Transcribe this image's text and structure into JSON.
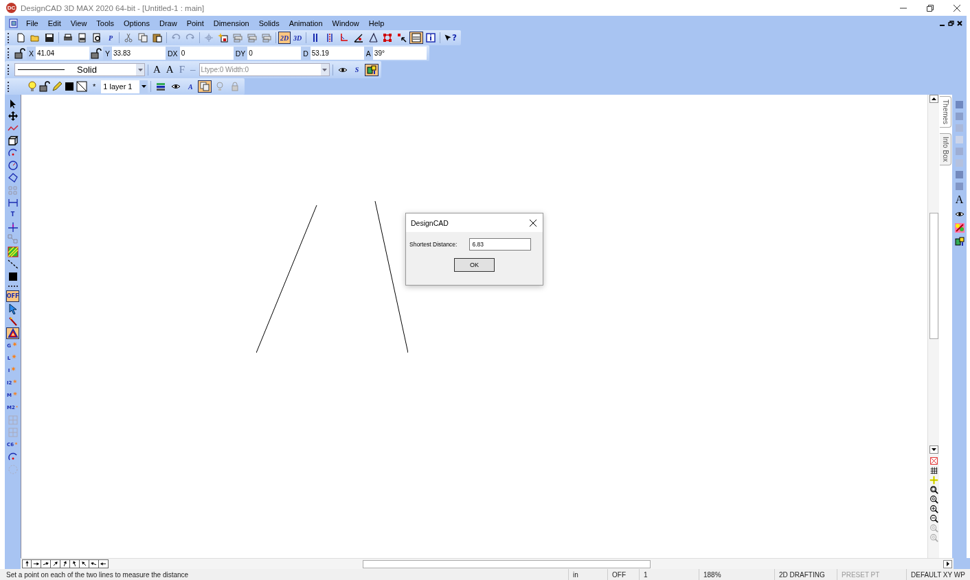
{
  "window": {
    "title": "DesignCAD 3D MAX 2020 64-bit - [Untitled-1 : main]",
    "app_badge": "DC"
  },
  "menu": [
    "File",
    "Edit",
    "View",
    "Tools",
    "Options",
    "Draw",
    "Point",
    "Dimension",
    "Solids",
    "Animation",
    "Window",
    "Help"
  ],
  "toolbar": [
    {
      "kind": "new-document",
      "selected": false
    },
    {
      "kind": "folder",
      "selected": false
    },
    {
      "kind": "floppy-disk",
      "selected": false
    },
    {
      "kind": "sep"
    },
    {
      "kind": "printer",
      "selected": false
    },
    {
      "kind": "printer-page",
      "selected": false
    },
    {
      "kind": "magnifier-page",
      "selected": false
    },
    {
      "kind": "letter",
      "label": "P",
      "selected": false
    },
    {
      "kind": "sep"
    },
    {
      "kind": "scissors",
      "selected": false
    },
    {
      "kind": "copy-pages",
      "selected": false
    },
    {
      "kind": "clipboard",
      "selected": false
    },
    {
      "kind": "sep"
    },
    {
      "kind": "undo-arrow",
      "selected": false
    },
    {
      "kind": "redo-arrow",
      "selected": false
    },
    {
      "kind": "sep"
    },
    {
      "kind": "crosshair",
      "selected": false
    },
    {
      "kind": "sparkle-page",
      "selected": false
    },
    {
      "kind": "stacked-frames",
      "selected": false
    },
    {
      "kind": "stacked-frames",
      "selected": false
    },
    {
      "kind": "stacked-frames",
      "selected": false
    },
    {
      "kind": "sep"
    },
    {
      "kind": "letter",
      "label": "2D",
      "selected": true
    },
    {
      "kind": "letter",
      "label": "3D",
      "selected": false
    },
    {
      "kind": "sep"
    },
    {
      "kind": "double-bar",
      "selected": false
    },
    {
      "kind": "dotted-bars",
      "selected": false
    },
    {
      "kind": "axes-arrow",
      "selected": false
    },
    {
      "kind": "angle-mark",
      "selected": false
    },
    {
      "kind": "angle-lines",
      "selected": false
    },
    {
      "kind": "square-handles",
      "selected": false
    },
    {
      "kind": "pointer-dot",
      "selected": false
    },
    {
      "kind": "panel",
      "selected": true
    },
    {
      "kind": "info",
      "selected": false
    },
    {
      "kind": "sep"
    },
    {
      "kind": "help-pointer",
      "label": "?",
      "selected": false
    }
  ],
  "coordinates": [
    {
      "kind": "locked",
      "label": "X",
      "value": "41.04"
    },
    {
      "kind": "locked",
      "label": "Y",
      "value": "33.83"
    },
    {
      "kind": "plain",
      "label": "DX",
      "value": "0"
    },
    {
      "kind": "plain",
      "label": "DY",
      "value": "0"
    },
    {
      "kind": "plain",
      "label": "D",
      "value": "53.19"
    },
    {
      "kind": "plain",
      "label": "A",
      "value": "39°"
    }
  ],
  "line_bar": {
    "line_style": "Solid",
    "font_buttons": [
      "A",
      "A",
      "F",
      "–"
    ],
    "line_type": {
      "value": "Ltype:0  Width:0",
      "disabled": true
    },
    "extra_buttons": [
      {
        "kind": "eye-pointer",
        "selected": false
      },
      {
        "kind": "letter",
        "label": "S",
        "selected": false
      },
      {
        "kind": "layers-arrow",
        "selected": true
      }
    ]
  },
  "layer_bar": {
    "marker": "*",
    "layer": "1  layer 1",
    "buttons": [
      {
        "kind": "layers-stack",
        "selected": false
      },
      {
        "kind": "eye-pointer",
        "selected": false
      },
      {
        "kind": "letter",
        "label": "A",
        "selected": false
      },
      {
        "kind": "copy-pages",
        "selected": true
      },
      {
        "kind": "bulb-grey",
        "selected": false
      },
      {
        "kind": "lock-grey",
        "selected": false
      }
    ]
  },
  "left_tools": [
    {
      "kind": "arrow-pointer",
      "selected": false
    },
    {
      "kind": "move-cross",
      "selected": false
    },
    {
      "kind": "polyline",
      "selected": false
    },
    {
      "kind": "cube",
      "selected": false
    },
    {
      "kind": "arc",
      "selected": false
    },
    {
      "kind": "circle",
      "selected": false
    },
    {
      "kind": "polygon",
      "selected": false
    },
    {
      "kind": "grid-dots",
      "selected": false
    },
    {
      "kind": "dimension",
      "selected": false
    },
    {
      "kind": "letter",
      "label": "T",
      "selected": false
    },
    {
      "kind": "cross-line",
      "selected": false
    },
    {
      "kind": "snap-boxes",
      "selected": false
    },
    {
      "kind": "hatch",
      "selected": false
    },
    {
      "kind": "dashed-line",
      "selected": false
    },
    {
      "kind": "black-square",
      "selected": false
    },
    {
      "kind": "grip"
    },
    {
      "kind": "letter",
      "label": "OFF",
      "selected": true
    },
    {
      "kind": "blue-pointer",
      "selected": false
    },
    {
      "kind": "wand",
      "selected": false
    },
    {
      "kind": "triangle",
      "selected": true
    },
    {
      "kind": "snap-letter",
      "label": "G",
      "selected": false
    },
    {
      "kind": "snap-letter",
      "label": "L",
      "selected": false
    },
    {
      "kind": "snap-letter",
      "label": "I",
      "selected": false
    },
    {
      "kind": "snap-letter",
      "label": "I2",
      "selected": false
    },
    {
      "kind": "snap-letter",
      "label": "M",
      "selected": false
    },
    {
      "kind": "snap-letter",
      "label": "M2",
      "selected": false
    },
    {
      "kind": "grid-box",
      "selected": false
    },
    {
      "kind": "grid-box",
      "selected": false
    },
    {
      "kind": "snap-letter",
      "label": "C6",
      "selected": false
    },
    {
      "kind": "arc",
      "selected": false
    },
    {
      "kind": "dotted-circle",
      "selected": false
    }
  ],
  "side_tabs": [
    {
      "label": "Themes",
      "selected": true
    },
    {
      "label": "Info Box",
      "selected": false
    }
  ],
  "right_tools": [
    {
      "kind": "swatch",
      "color": "#6f88c0"
    },
    {
      "kind": "swatch",
      "color": "#8a9fcc"
    },
    {
      "kind": "swatch",
      "color": "#a9b8da"
    },
    {
      "kind": "swatch",
      "color": "#ccd5ea"
    },
    {
      "kind": "swatch",
      "color": "#9eaed4"
    },
    {
      "kind": "swatch",
      "color": "#b4c1df"
    },
    {
      "kind": "swatch",
      "color": "#7389bd"
    },
    {
      "kind": "swatch",
      "color": "#8196c6"
    },
    {
      "kind": "letter",
      "label": "A"
    },
    {
      "kind": "eye-pointer"
    },
    {
      "kind": "palette"
    },
    {
      "kind": "layers-arrow"
    }
  ],
  "zoom_tools": [
    {
      "kind": "red-x"
    },
    {
      "kind": "hash"
    },
    {
      "kind": "yellow-cross"
    },
    {
      "kind": "zoom-window"
    },
    {
      "kind": "zoom-extents"
    },
    {
      "kind": "zoom-in"
    },
    {
      "kind": "zoom-out"
    },
    {
      "kind": "zoom-grey"
    },
    {
      "kind": "zoom-grey"
    }
  ],
  "direction_buttons": [
    {
      "kind": "up"
    },
    {
      "kind": "right"
    },
    {
      "kind": "low-right"
    },
    {
      "kind": "up-right"
    },
    {
      "kind": "steep-right"
    },
    {
      "kind": "steep-left"
    },
    {
      "kind": "up-left"
    },
    {
      "kind": "low-left"
    },
    {
      "kind": "left"
    }
  ],
  "dialog": {
    "title": "DesignCAD",
    "label": "Shortest Distance:",
    "value": "6.83",
    "ok": "OK"
  },
  "status_bar": {
    "message": "Set a point on each of the two lines to measure the distance",
    "fields": [
      {
        "text": "in",
        "disabled": false
      },
      {
        "text": "OFF",
        "disabled": false
      },
      {
        "text": "1",
        "disabled": false
      },
      {
        "text": "188%",
        "disabled": false
      },
      {
        "text": "2D DRAFTING",
        "disabled": false
      },
      {
        "text": "PRESET PT",
        "disabled": true
      },
      {
        "text": "DEFAULT XY WP",
        "disabled": false
      }
    ]
  }
}
